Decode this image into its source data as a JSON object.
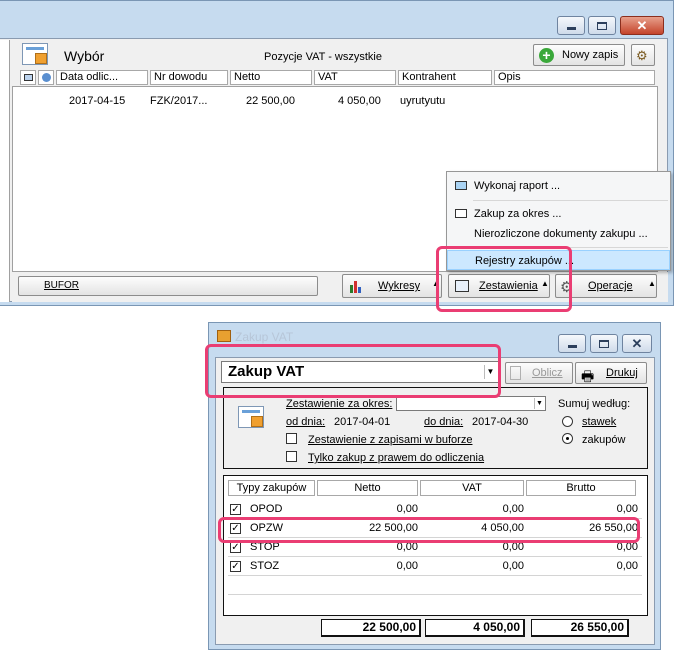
{
  "main_window": {
    "header": {
      "title": "Wybór",
      "subtitle": "Pozycje VAT - wszystkie",
      "new_record_label": "Nowy zapis"
    },
    "columns": [
      "Data odlic...",
      "Nr dowodu",
      "Netto",
      "VAT",
      "Kontrahent",
      "Opis"
    ],
    "rows": [
      {
        "date": "2017-04-15",
        "doc_no": "FZK/2017...",
        "net": "22 500,00",
        "vat": "4 050,00",
        "contractor": "uyrutyutu",
        "desc": ""
      }
    ],
    "bottom_bar": {
      "bufor_label": "BUFOR",
      "charts_label": "Wykresy",
      "reports_label": "Zestawienia",
      "operations_label": "Operacje"
    },
    "context_menu": {
      "items": [
        "Wykonaj raport ...",
        "Zakup za okres ...",
        "Nierozliczone dokumenty zakupu ...",
        "Rejestry zakupów ..."
      ]
    }
  },
  "dialog": {
    "title": "Zakup VAT",
    "combo_value": "Zakup VAT",
    "calc_label": "Oblicz",
    "print_label": "Drukuj",
    "period_label": "Zestawienie za okres:",
    "period_value": "",
    "from_label": "od dnia:",
    "from_value": "2017-04-01",
    "to_label": "do dnia:",
    "to_value": "2017-04-30",
    "sum_by_label": "Sumuj według:",
    "rates_label": "stawek",
    "purchases_label": "zakupów",
    "buffer_checkbox_label": "Zestawienie z zapisami w buforze",
    "deduction_checkbox_label": "Tylko zakup z prawem do odliczenia",
    "table": {
      "headers": [
        "Typy zakupów",
        "Netto",
        "VAT",
        "Brutto"
      ],
      "rows": [
        {
          "name": "OPOD",
          "net": "0,00",
          "vat": "0,00",
          "gross": "0,00"
        },
        {
          "name": "OPZW",
          "net": "22 500,00",
          "vat": "4 050,00",
          "gross": "26 550,00"
        },
        {
          "name": "STOP",
          "net": "0,00",
          "vat": "0,00",
          "gross": "0,00"
        },
        {
          "name": "STOZ",
          "net": "0,00",
          "vat": "0,00",
          "gross": "0,00"
        }
      ]
    },
    "totals": {
      "net": "22 500,00",
      "vat": "4 050,00",
      "gross": "26 550,00"
    }
  },
  "colors": {
    "frame": "#c6dbef",
    "highlight": "#ea3d73",
    "menu_highlight": "#cce8ff"
  }
}
